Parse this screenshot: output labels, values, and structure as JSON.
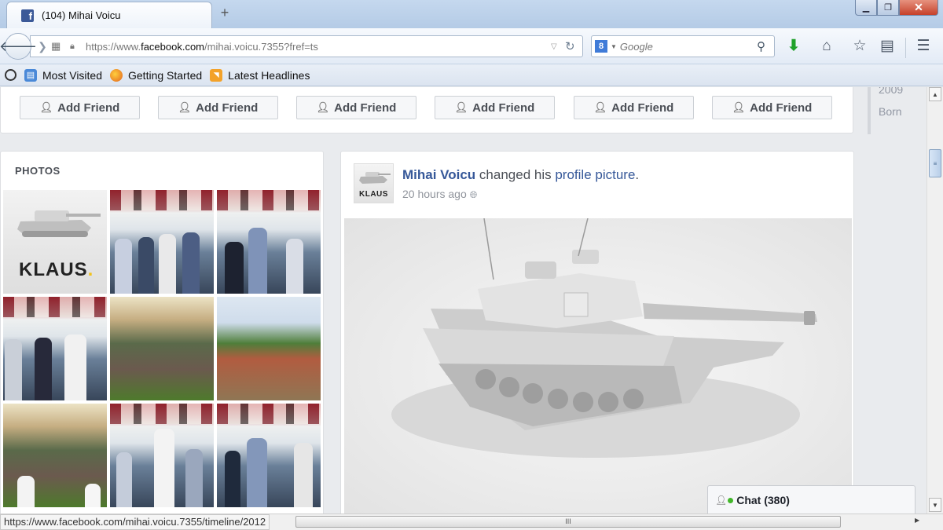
{
  "browser": {
    "tab_title": "(104) Mihai Voicu",
    "favicon_letter": "f",
    "new_tab_symbol": "+",
    "url_prefix": "https://www.",
    "url_domain": "facebook.com",
    "url_path": "/mihai.voicu.7355?fref=ts",
    "search_placeholder": "Google",
    "search_engine_letter": "8",
    "bookmarks": [
      "Most Visited",
      "Getting Started",
      "Latest Headlines"
    ]
  },
  "friends": {
    "add_friend_label": "Add Friend",
    "buttons": [
      "Add Friend",
      "Add Friend",
      "Add Friend",
      "Add Friend",
      "Add Friend",
      "Add Friend"
    ]
  },
  "timeline": {
    "years": [
      "2009",
      "Born"
    ]
  },
  "photos": {
    "title": "PHOTOS",
    "klaus_text": "KLAUS",
    "klaus_dot": ".",
    "thumbs": [
      "klaus",
      "event",
      "event",
      "event",
      "crowd",
      "park",
      "crowd",
      "event",
      "event"
    ]
  },
  "post": {
    "author": "Mihai Voicu",
    "action_text": " changed his ",
    "link_text": "profile picture",
    "period": ".",
    "time": "20 hours ago",
    "avatar_text": "KLAUS"
  },
  "chat": {
    "label": "Chat (380)"
  },
  "status": {
    "url": "https://www.facebook.com/mihai.voicu.7355/timeline/2012",
    "hscroll_grip": "III"
  },
  "colors": {
    "facebook_blue": "#365899",
    "online_green": "#42b72a",
    "close_red": "#c6412a"
  }
}
